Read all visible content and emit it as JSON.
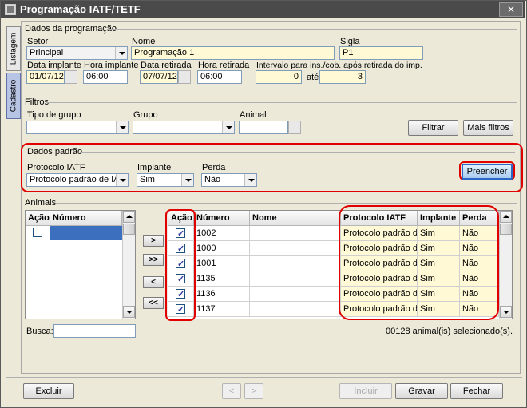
{
  "window": {
    "title": "Programação IATF/TETF",
    "close_glyph": "✕"
  },
  "side_tabs": [
    {
      "label": "Listagem"
    },
    {
      "label": "Cadastro"
    }
  ],
  "dados_programacao": {
    "title": "Dados da programação",
    "setor_label": "Setor",
    "setor_value": "Principal",
    "nome_label": "Nome",
    "nome_value": "Programação 1",
    "sigla_label": "Sigla",
    "sigla_value": "P1",
    "data_implante_label": "Data implante",
    "data_implante_value": "01/07/12",
    "hora_implante_label": "Hora implante",
    "hora_implante_value": "06:00",
    "data_retirada_label": "Data retirada",
    "data_retirada_value": "07/07/12",
    "hora_retirada_label": "Hora retirada",
    "hora_retirada_value": "06:00",
    "intervalo_label": "Intervalo para ins./cob. após retirada do imp.",
    "intervalo_from": "0",
    "ate_label": "até",
    "intervalo_to": "3"
  },
  "filtros": {
    "title": "Filtros",
    "tipo_grupo_label": "Tipo de grupo",
    "tipo_grupo_value": "",
    "grupo_label": "Grupo",
    "grupo_value": "",
    "animal_label": "Animal",
    "animal_value": "",
    "filtrar_label": "Filtrar",
    "mais_filtros_label": "Mais filtros"
  },
  "dados_padrao": {
    "title": "Dados padrão",
    "protocolo_label": "Protocolo IATF",
    "protocolo_value": "Protocolo padrão de IATF",
    "implante_label": "Implante",
    "implante_value": "Sim",
    "perda_label": "Perda",
    "perda_value": "Não",
    "preencher_label": "Preencher"
  },
  "animais": {
    "title": "Animais",
    "left_headers": [
      "Ação",
      "Número"
    ],
    "move_buttons": [
      ">",
      ">>",
      "<",
      "<<"
    ],
    "right_headers": [
      "Ação",
      "Número",
      "Nome",
      "Protocolo IATF",
      "Implante",
      "Perda"
    ],
    "rows": [
      {
        "checked": true,
        "numero": "1002",
        "nome": "",
        "protocolo": "Protocolo padrão de IATF",
        "implante": "Sim",
        "perda": "Não"
      },
      {
        "checked": true,
        "numero": "1000",
        "nome": "",
        "protocolo": "Protocolo padrão de IATF",
        "implante": "Sim",
        "perda": "Não"
      },
      {
        "checked": true,
        "numero": "1001",
        "nome": "",
        "protocolo": "Protocolo padrão de IATF",
        "implante": "Sim",
        "perda": "Não"
      },
      {
        "checked": true,
        "numero": "1135",
        "nome": "",
        "protocolo": "Protocolo padrão de IATF",
        "implante": "Sim",
        "perda": "Não"
      },
      {
        "checked": true,
        "numero": "1136",
        "nome": "",
        "protocolo": "Protocolo padrão de IATF",
        "implante": "Sim",
        "perda": "Não"
      },
      {
        "checked": true,
        "numero": "1137",
        "nome": "",
        "protocolo": "Protocolo padrão de IATF",
        "implante": "Sim",
        "perda": "Não"
      }
    ],
    "busca_label": "Busca:",
    "busca_value": "",
    "selected_count": "00128 animal(is) selecionado(s)."
  },
  "footer": {
    "excluir_label": "Excluir",
    "prev_glyph": "<",
    "next_glyph": ">",
    "incluir_label": "Incluir",
    "gravar_label": "Gravar",
    "fechar_label": "Fechar"
  },
  "colors": {
    "titlebar": "#4a4a4a",
    "highlight": "#e00000",
    "readonly_bg": "#fff9d6",
    "primary_border": "#2a68c8"
  },
  "icons": {
    "window": "app-window-icon",
    "check": "checkmark-icon"
  }
}
